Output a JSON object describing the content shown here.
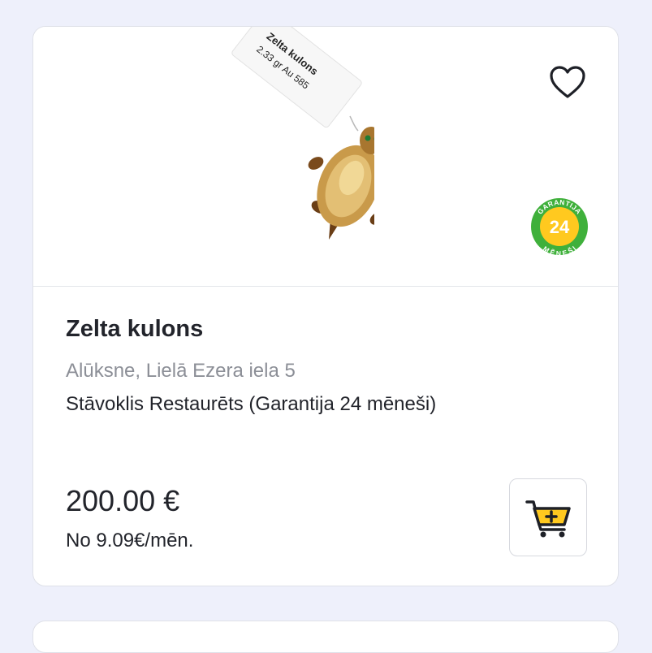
{
  "product": {
    "title": "Zelta kulons",
    "location": "Alūksne, Lielā Ezera iela 5",
    "condition": "Stāvoklis Restaurēts (Garantija 24 mēneši)",
    "price": "200.00 €",
    "monthly": "No 9.09€/mēn.",
    "tag_line1": "Zelta kulons",
    "tag_line2": "2.33 gr Au 585"
  },
  "badge": {
    "top_text": "GARANTIJA",
    "number": "24",
    "bottom_text": "MĒNEŠI",
    "ring_color": "#3fb03b",
    "fill_color": "#ffc91f"
  },
  "icons": {
    "favorite": "heart-outline-icon",
    "cart": "add-to-cart-icon"
  },
  "colors": {
    "accent": "#ffc91f",
    "text": "#22242b",
    "muted": "#8c8f97",
    "background": "#eef0fb"
  }
}
